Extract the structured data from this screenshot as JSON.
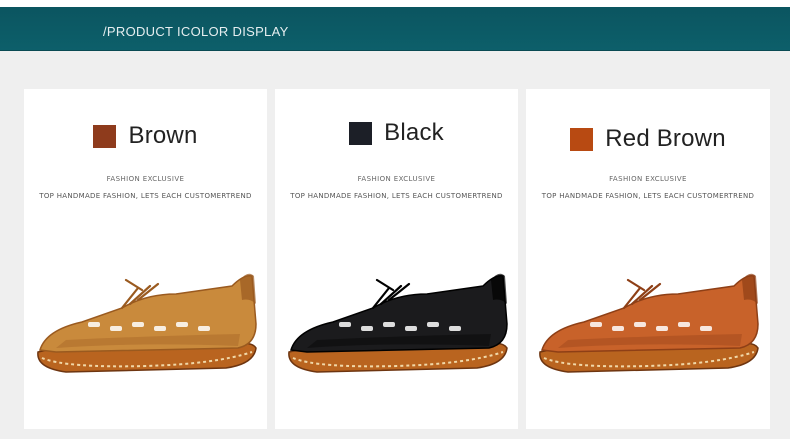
{
  "banner": {
    "title": "/PRODUCT ICOLOR DISPLAY"
  },
  "cards": [
    {
      "color_name": "Brown",
      "swatch": "#8e3b1c",
      "tagline": "FASHION EXCLUSIVE",
      "subtitle": "TOP HANDMADE FASHION, LETS EACH CUSTOMERTREND",
      "shoe_color": "#c98a3c",
      "shoe_shade": "#9a5a1f"
    },
    {
      "color_name": "Black",
      "swatch": "#1c1f27",
      "tagline": "FASHION EXCLUSIVE",
      "subtitle": "TOP HANDMADE FASHION, LETS EACH CUSTOMERTREND",
      "shoe_color": "#1b1b1d",
      "shoe_shade": "#000000"
    },
    {
      "color_name": "Red Brown",
      "swatch": "#b84a12",
      "tagline": "FASHION EXCLUSIVE",
      "subtitle": "TOP HANDMADE FASHION, LETS EACH CUSTOMERTREND",
      "shoe_color": "#c8622a",
      "shoe_shade": "#8e3f16"
    }
  ]
}
